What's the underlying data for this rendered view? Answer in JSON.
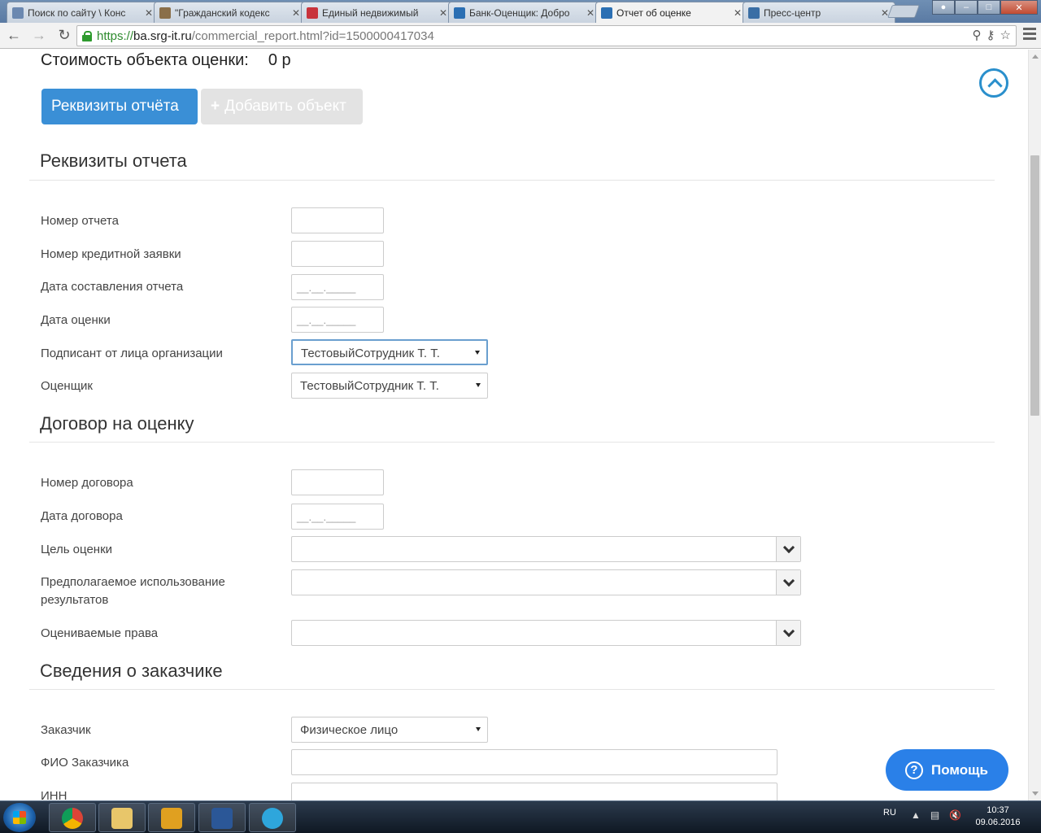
{
  "browser": {
    "tabs": [
      {
        "title": "Поиск по сайту \\ Конс",
        "favicon_color": "#6b88b0",
        "active": false
      },
      {
        "title": "\"Гражданский кодекс",
        "favicon_color": "#8a6f4a",
        "active": false
      },
      {
        "title": "Единый недвижимый",
        "favicon_color": "#c8333c",
        "active": false
      },
      {
        "title": "Банк-Оценщик: Добро",
        "favicon_color": "#2b6fb3",
        "active": false
      },
      {
        "title": "Отчет об оценке",
        "favicon_color": "#2b6fb3",
        "active": true
      },
      {
        "title": "Пресс-центр",
        "favicon_color": "#3a6ea5",
        "active": false
      }
    ],
    "tab_close_glyph": "✕",
    "url_scheme": "https://",
    "url_host": "ba.srg-it.ru",
    "url_path": "/commercial_report.html?id=1500000417034"
  },
  "page": {
    "cost_label": "Стоимость объекта оценки:",
    "cost_value": "0 р",
    "tab_primary": "Реквизиты отчёта",
    "tab_disabled_plus": "+",
    "tab_disabled": "Добавить объект",
    "accent_color": "#3a8fd6",
    "sections": {
      "requisites": {
        "title": "Реквизиты отчета",
        "report_number": "Номер отчета",
        "credit_request": "Номер кредитной заявки",
        "report_date": "Дата составления отчета",
        "valuation_date": "Дата оценки",
        "signer": "Подписант от лица организации",
        "signer_value": "ТестовыйСотрудник Т. Т.",
        "appraiser": "Оценщик",
        "appraiser_value": "ТестовыйСотрудник Т. Т.",
        "date_mask": "__.__._____"
      },
      "contract": {
        "title": "Договор на оценку",
        "contract_number": "Номер договора",
        "contract_date": "Дата договора",
        "purpose": "Цель оценки",
        "intended_use": "Предполагаемое использование результатов",
        "rights": "Оцениваемые права",
        "date_mask": "__.__._____"
      },
      "customer": {
        "title": "Сведения о заказчике",
        "customer": "Заказчик",
        "customer_value": "Физическое лицо",
        "fio": "ФИО Заказчика",
        "inn": "ИНН"
      }
    },
    "help_label": "Помощь",
    "help_icon_glyph": "?"
  },
  "taskbar": {
    "apps": [
      {
        "name": "chrome",
        "color": "#e7a117"
      },
      {
        "name": "explorer",
        "color": "#e8c66a"
      },
      {
        "name": "outlook",
        "color": "#e0a020"
      },
      {
        "name": "word",
        "color": "#2b5797"
      },
      {
        "name": "telegram",
        "color": "#2ea6dc"
      }
    ],
    "lang": "RU",
    "time": "10:37",
    "date": "09.06.2016"
  }
}
